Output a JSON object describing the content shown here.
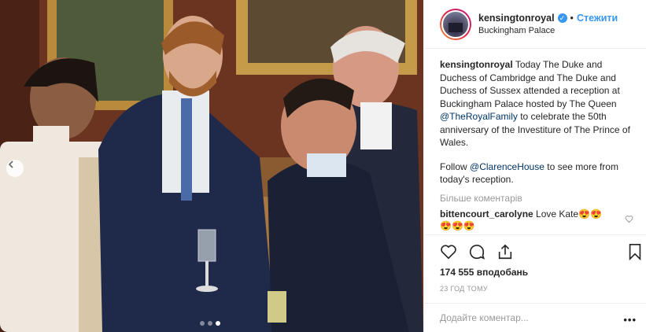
{
  "header": {
    "username": "kensingtonroyal",
    "follow_label": "Стежити",
    "location": "Buckingham Palace",
    "separator": "•"
  },
  "caption": {
    "author": "kensingtonroyal",
    "text_part1": "Today The Duke and Duchess of Cambridge and The Duke and Duchess of Sussex attended a reception at Buckingham Palace hosted by The Queen ",
    "mention1": "@TheRoyalFamily",
    "text_part2": " to celebrate the 50th anniversary of the Investiture of The Prince of Wales.",
    "para2_part1": "Follow ",
    "mention2": "@ClarenceHouse",
    "para2_part2": " to see more from today's reception."
  },
  "more_comments_label": "Більше коментарів",
  "comments": [
    {
      "user": "bittencourt_carolyne",
      "text": "Love Kate",
      "emojis_inline": "😍😍",
      "emojis_line2": "😍😍😍"
    }
  ],
  "likes": "174 555 вподобань",
  "timestamp": "23 ГОД ТОМУ",
  "add_comment": {
    "placeholder": "Додайте коментар...",
    "more_label": "•••"
  },
  "carousel": {
    "current": 3,
    "total": 3
  },
  "icons": [
    "chevron-left-icon",
    "verified-icon",
    "heart-icon",
    "comment-icon",
    "share-icon",
    "bookmark-icon",
    "heart-small-icon"
  ],
  "colors": {
    "link": "#3897f0",
    "mention": "#003569",
    "muted": "#999999",
    "border": "#efefef"
  }
}
